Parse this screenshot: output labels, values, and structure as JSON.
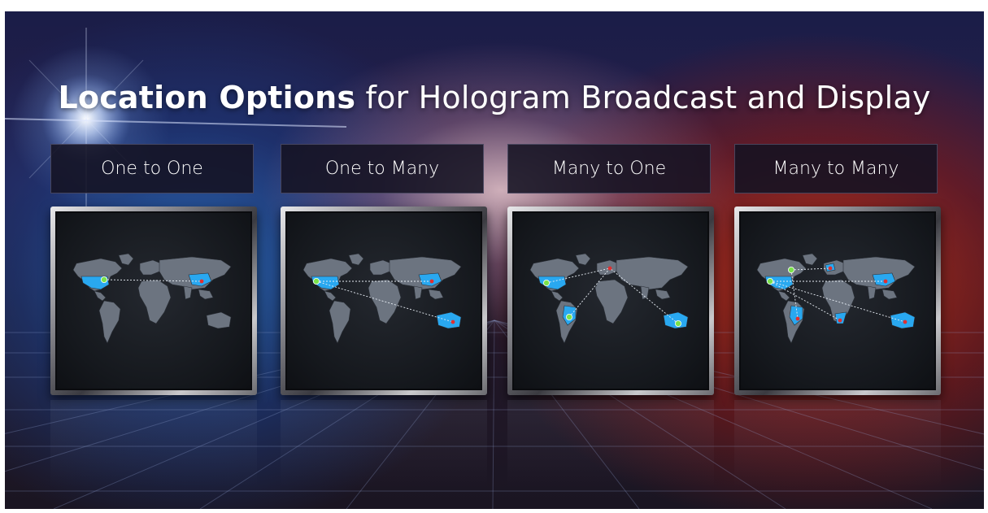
{
  "title": {
    "bold": "Location Options",
    "rest": " for Hologram Broadcast and Display"
  },
  "options": [
    {
      "label": "One to One"
    },
    {
      "label": "One to Many"
    },
    {
      "label": "Many to One"
    },
    {
      "label": "Many to Many"
    }
  ],
  "colors": {
    "highlight_country": "#29a8f0",
    "land": "#6c7480",
    "source_dot": "#7be24a",
    "target_dot": "#e03030"
  }
}
